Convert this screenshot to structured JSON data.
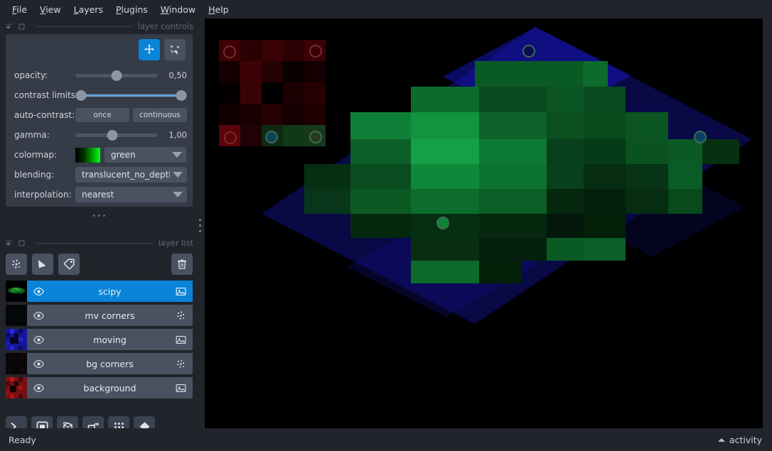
{
  "menu": {
    "items": [
      {
        "label": "File",
        "mnemonic": "F"
      },
      {
        "label": "View",
        "mnemonic": "V"
      },
      {
        "label": "Layers",
        "mnemonic": "L"
      },
      {
        "label": "Plugins",
        "mnemonic": "P"
      },
      {
        "label": "Window",
        "mnemonic": "W"
      },
      {
        "label": "Help",
        "mnemonic": "H"
      }
    ]
  },
  "docks": {
    "layer_controls_title": "layer controls",
    "layer_list_title": "layer list"
  },
  "layer_controls": {
    "modes": [
      {
        "name": "pan-zoom-mode-button",
        "icon": "move-icon",
        "active": true
      },
      {
        "name": "transform-mode-button",
        "icon": "transform-icon",
        "active": false
      }
    ],
    "opacity": {
      "label": "opacity:",
      "value": "0,50",
      "fraction": 0.5
    },
    "contrast_limits": {
      "label": "contrast limits:",
      "low": 0.0,
      "high": 1.0
    },
    "auto_contrast": {
      "label": "auto-contrast:",
      "once": "once",
      "continuous": "continuous"
    },
    "gamma": {
      "label": "gamma:",
      "value": "1,00",
      "fraction": 0.45
    },
    "colormap": {
      "label": "colormap:",
      "value": "green"
    },
    "blending": {
      "label": "blending:",
      "value": "translucent_no_depth"
    },
    "interpolation": {
      "label": "interpolation:",
      "value": "nearest"
    }
  },
  "layer_buttons": [
    {
      "name": "new-points-layer-button",
      "icon": "points-icon"
    },
    {
      "name": "new-shapes-layer-button",
      "icon": "shapes-icon"
    },
    {
      "name": "new-labels-layer-button",
      "icon": "labels-icon"
    },
    {
      "name": "delete-layer-button",
      "icon": "trash-icon"
    }
  ],
  "layers": [
    {
      "name": "scipy",
      "type": "image",
      "visible": true,
      "selected": true,
      "thumb": "green-blob"
    },
    {
      "name": "mv corners",
      "type": "points",
      "visible": true,
      "selected": false,
      "thumb": "dark-dots"
    },
    {
      "name": "moving",
      "type": "image",
      "visible": true,
      "selected": false,
      "thumb": "blue-checker"
    },
    {
      "name": "bg corners",
      "type": "points",
      "visible": true,
      "selected": false,
      "thumb": "dark-red-dots"
    },
    {
      "name": "background",
      "type": "image",
      "visible": true,
      "selected": false,
      "thumb": "red-checker"
    }
  ],
  "viewer_buttons": [
    {
      "name": "console-button",
      "icon": "console-icon"
    },
    {
      "name": "ndisplay-2d-button",
      "icon": "square-icon"
    },
    {
      "name": "ndisplay-3d-button",
      "icon": "cube-icon"
    },
    {
      "name": "roll-dims-button",
      "icon": "roll-icon"
    },
    {
      "name": "transpose-dims-button",
      "icon": "grid-icon"
    },
    {
      "name": "reset-view-button",
      "icon": "home-icon"
    }
  ],
  "statusbar": {
    "status": "Ready",
    "activity": "activity"
  },
  "canvas": {
    "background": "#000000",
    "moving_layer_color": "#1020a8",
    "scipy_layer_color": "#00a83c",
    "background_layer_color": "#a81010"
  }
}
